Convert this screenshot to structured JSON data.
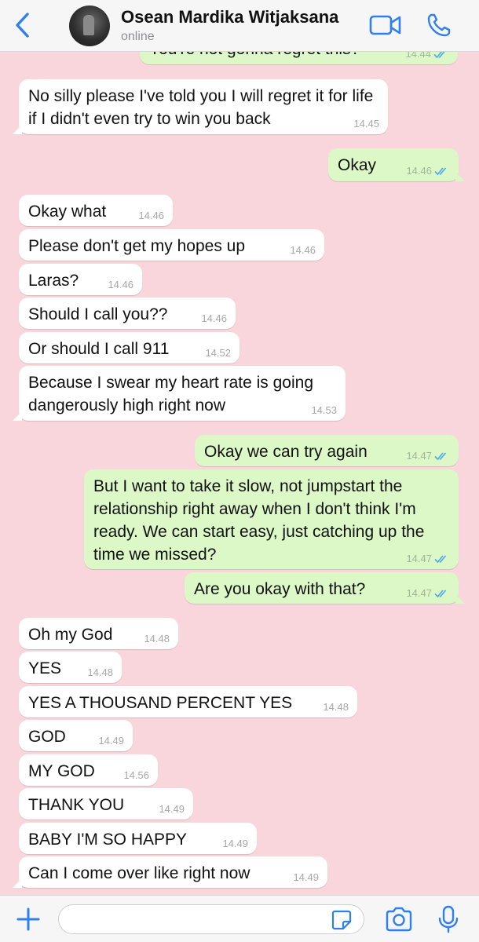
{
  "header": {
    "contact_name": "Osean Mardika Witjaksana",
    "status": "online",
    "icons": [
      "chevron-left-icon",
      "video-camera-icon",
      "phone-icon"
    ]
  },
  "colors": {
    "chat_background": "#f8d6dc",
    "incoming_bubble": "#ffffff",
    "outgoing_bubble": "#dcf8c6",
    "accent_blue": "#2f80ed",
    "read_ticks": "#4fa8e8"
  },
  "messages": [
    {
      "side": "out",
      "text": "You're not gonna regret this?",
      "time": "14.44",
      "read": true
    },
    {
      "side": "in",
      "text": "No silly please I've told you I will regret it for life if I didn't even try to win you back",
      "time": "14.45"
    },
    {
      "side": "out",
      "text": "Okay",
      "time": "14.46",
      "read": true
    },
    {
      "side": "in",
      "text": "Okay what",
      "time": "14.46"
    },
    {
      "side": "in",
      "text": "Please don't get my hopes up",
      "time": "14.46"
    },
    {
      "side": "in",
      "text": "Laras?",
      "time": "14.46"
    },
    {
      "side": "in",
      "text": "Should I call you??",
      "time": "14.46"
    },
    {
      "side": "in",
      "text": "Or should I call 911",
      "time": "14.52"
    },
    {
      "side": "in",
      "text": "Because I swear my heart rate is going dangerously high right now",
      "time": "14.53"
    },
    {
      "side": "out",
      "text": "Okay we can try again",
      "time": "14.47",
      "read": true
    },
    {
      "side": "out",
      "text": "But I want to take it slow, not jumpstart the relationship right away when I don't think I'm ready. We can start easy, just catching up the time we missed?",
      "time": "14.47",
      "read": true
    },
    {
      "side": "out",
      "text": "Are you okay with that?",
      "time": "14.47",
      "read": true
    },
    {
      "side": "in",
      "text": "Oh my God",
      "time": "14.48"
    },
    {
      "side": "in",
      "text": "YES",
      "time": "14.48"
    },
    {
      "side": "in",
      "text": "YES A THOUSAND PERCENT YES",
      "time": "14.48"
    },
    {
      "side": "in",
      "text": "GOD",
      "time": "14.49"
    },
    {
      "side": "in",
      "text": "MY GOD",
      "time": "14.56"
    },
    {
      "side": "in",
      "text": "THANK YOU",
      "time": "14.49"
    },
    {
      "side": "in",
      "text": "BABY I'M SO HAPPY",
      "time": "14.49"
    },
    {
      "side": "in",
      "text": "Can I come over like right now",
      "time": "14.49"
    }
  ],
  "composer": {
    "value": "",
    "icons": [
      "plus-icon",
      "sticker-icon",
      "camera-icon",
      "microphone-icon"
    ]
  }
}
